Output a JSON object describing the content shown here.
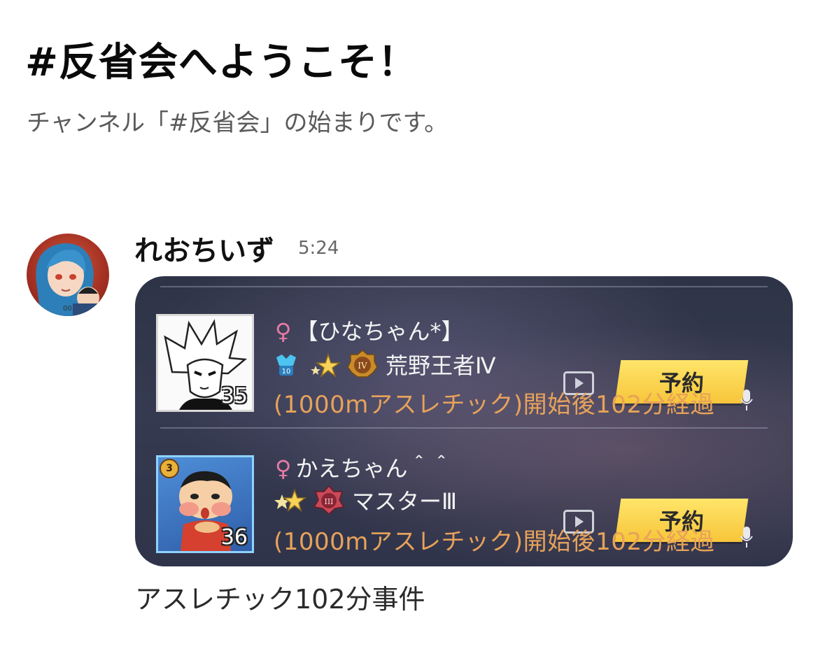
{
  "channel": {
    "welcome_title": "#反省会へようこそ！",
    "welcome_subtitle": "チャンネル「#反省会」の始まりです。"
  },
  "message": {
    "author": "れおちいず",
    "time": "5:24",
    "caption": "アスレチック102分事件",
    "attachment": {
      "players": [
        {
          "gender_icon": "female-icon",
          "name": "【ひなちゃん*】",
          "rank": "荒野王者Ⅳ",
          "level": "35",
          "rank_badge_label": "IV",
          "power_badge_label": "10",
          "status": "(1000mアスレチック)開始後102分経過",
          "button_label": "予約"
        },
        {
          "gender_icon": "female-icon",
          "name": "かえちゃん＾＾",
          "rank": "マスターⅢ",
          "level": "36",
          "rank_badge_label": "III",
          "avatar_badge_label": "3",
          "status": "(1000mアスレチック)開始後102分経過",
          "button_label": "予約"
        }
      ]
    }
  },
  "colors": {
    "card_bg": "#30344a",
    "status_orange": "#e7a25a",
    "gender_pink": "#e87aa6",
    "button_yellow": "#f7c53a"
  }
}
